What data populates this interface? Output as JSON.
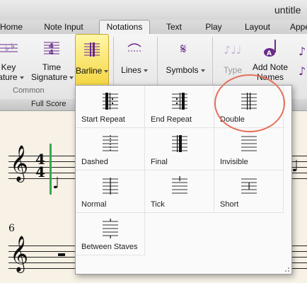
{
  "window": {
    "title": "untitle"
  },
  "tabs": [
    {
      "label": "Home",
      "active": false
    },
    {
      "label": "Note Input",
      "active": false
    },
    {
      "label": "Notations",
      "active": true
    },
    {
      "label": "Text",
      "active": false
    },
    {
      "label": "Play",
      "active": false
    },
    {
      "label": "Layout",
      "active": false
    },
    {
      "label": "Appe",
      "active": false
    }
  ],
  "ribbon": {
    "key_signature": {
      "line1": "Key",
      "line2": "nature"
    },
    "time_signature": {
      "line1": "Time",
      "line2": "Signature"
    },
    "barline": {
      "label": "Barline",
      "active": true
    },
    "lines": {
      "label": "Lines"
    },
    "symbols": {
      "label": "Symbols"
    },
    "type": {
      "label": "Type"
    },
    "add_note_names": {
      "line1": "Add Note",
      "line2": "Names"
    },
    "group_common": "Common"
  },
  "score": {
    "strip_label": "Full Score",
    "measure_number": "6",
    "time_sig": "4"
  },
  "barline_menu": {
    "items": [
      {
        "label": "Start Repeat",
        "icon": "start-repeat-barline-icon"
      },
      {
        "label": "End Repeat",
        "icon": "end-repeat-barline-icon"
      },
      {
        "label": "Double",
        "icon": "double-barline-icon"
      },
      {
        "label": "Dashed",
        "icon": "dashed-barline-icon"
      },
      {
        "label": "Final",
        "icon": "final-barline-icon"
      },
      {
        "label": "Invisible",
        "icon": "invisible-barline-icon"
      },
      {
        "label": "Normal",
        "icon": "normal-barline-icon"
      },
      {
        "label": "Tick",
        "icon": "tick-barline-icon"
      },
      {
        "label": "Short",
        "icon": "short-barline-icon"
      },
      {
        "label": "Between Staves",
        "icon": "between-staves-barline-icon"
      }
    ]
  },
  "colors": {
    "accent_yellow": "#f3d33a",
    "highlight_ring": "#e4705a",
    "selection_green": "#3aa84f",
    "ribbon_purple": "#6a2a8a"
  }
}
